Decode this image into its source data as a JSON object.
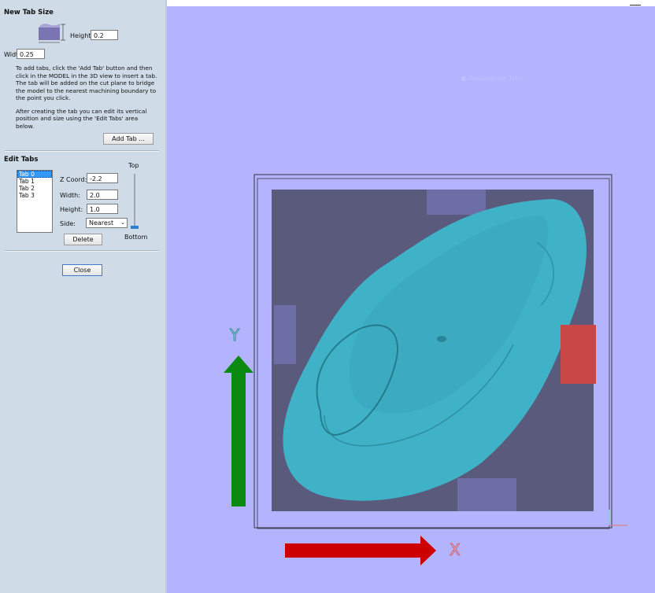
{
  "new_tab_size": {
    "title": "New Tab Size",
    "height_label": "Height:",
    "height_value": "0.2",
    "width_label": "Width:",
    "width_value": "0.25",
    "help_1": "To add tabs, click the 'Add Tab' button and then click in the MODEL in the 3D view to insert a tab. The tab will be added on the cut plane to bridge the model to the nearest machining boundary to the point you click.",
    "help_2": "After creating the tab you can edit its vertical position and size using the 'Edit Tabs' area below.",
    "add_tab_label": "Add Tab ..."
  },
  "edit_tabs": {
    "title": "Edit Tabs",
    "tabs": [
      "Tab 0",
      "Tab 1",
      "Tab 2",
      "Tab 3"
    ],
    "selected_index": 0,
    "zcoord_label": "Z Coord:",
    "zcoord_value": "-2.2",
    "width_label": "Width:",
    "width_value": "2.0",
    "height_label": "Height:",
    "height_value": "1.0",
    "side_label": "Side:",
    "side_value": "Nearest",
    "top_label": "Top",
    "bottom_label": "Bottom",
    "slider_level": 0.0,
    "delete_label": "Delete"
  },
  "close_label": "Close",
  "viewport": {
    "background": "#b3b3fe",
    "watermark": "Rectangular Tabs",
    "axis_y_label": "Y",
    "axis_x_label": "X",
    "colors": {
      "y_arrow": "#0a8a10",
      "x_arrow": "#cc0000",
      "block": "#5a5a7c",
      "model": "#3fb2c8",
      "tab": "#6e6ea6",
      "selected_tab": "#c84848"
    }
  }
}
